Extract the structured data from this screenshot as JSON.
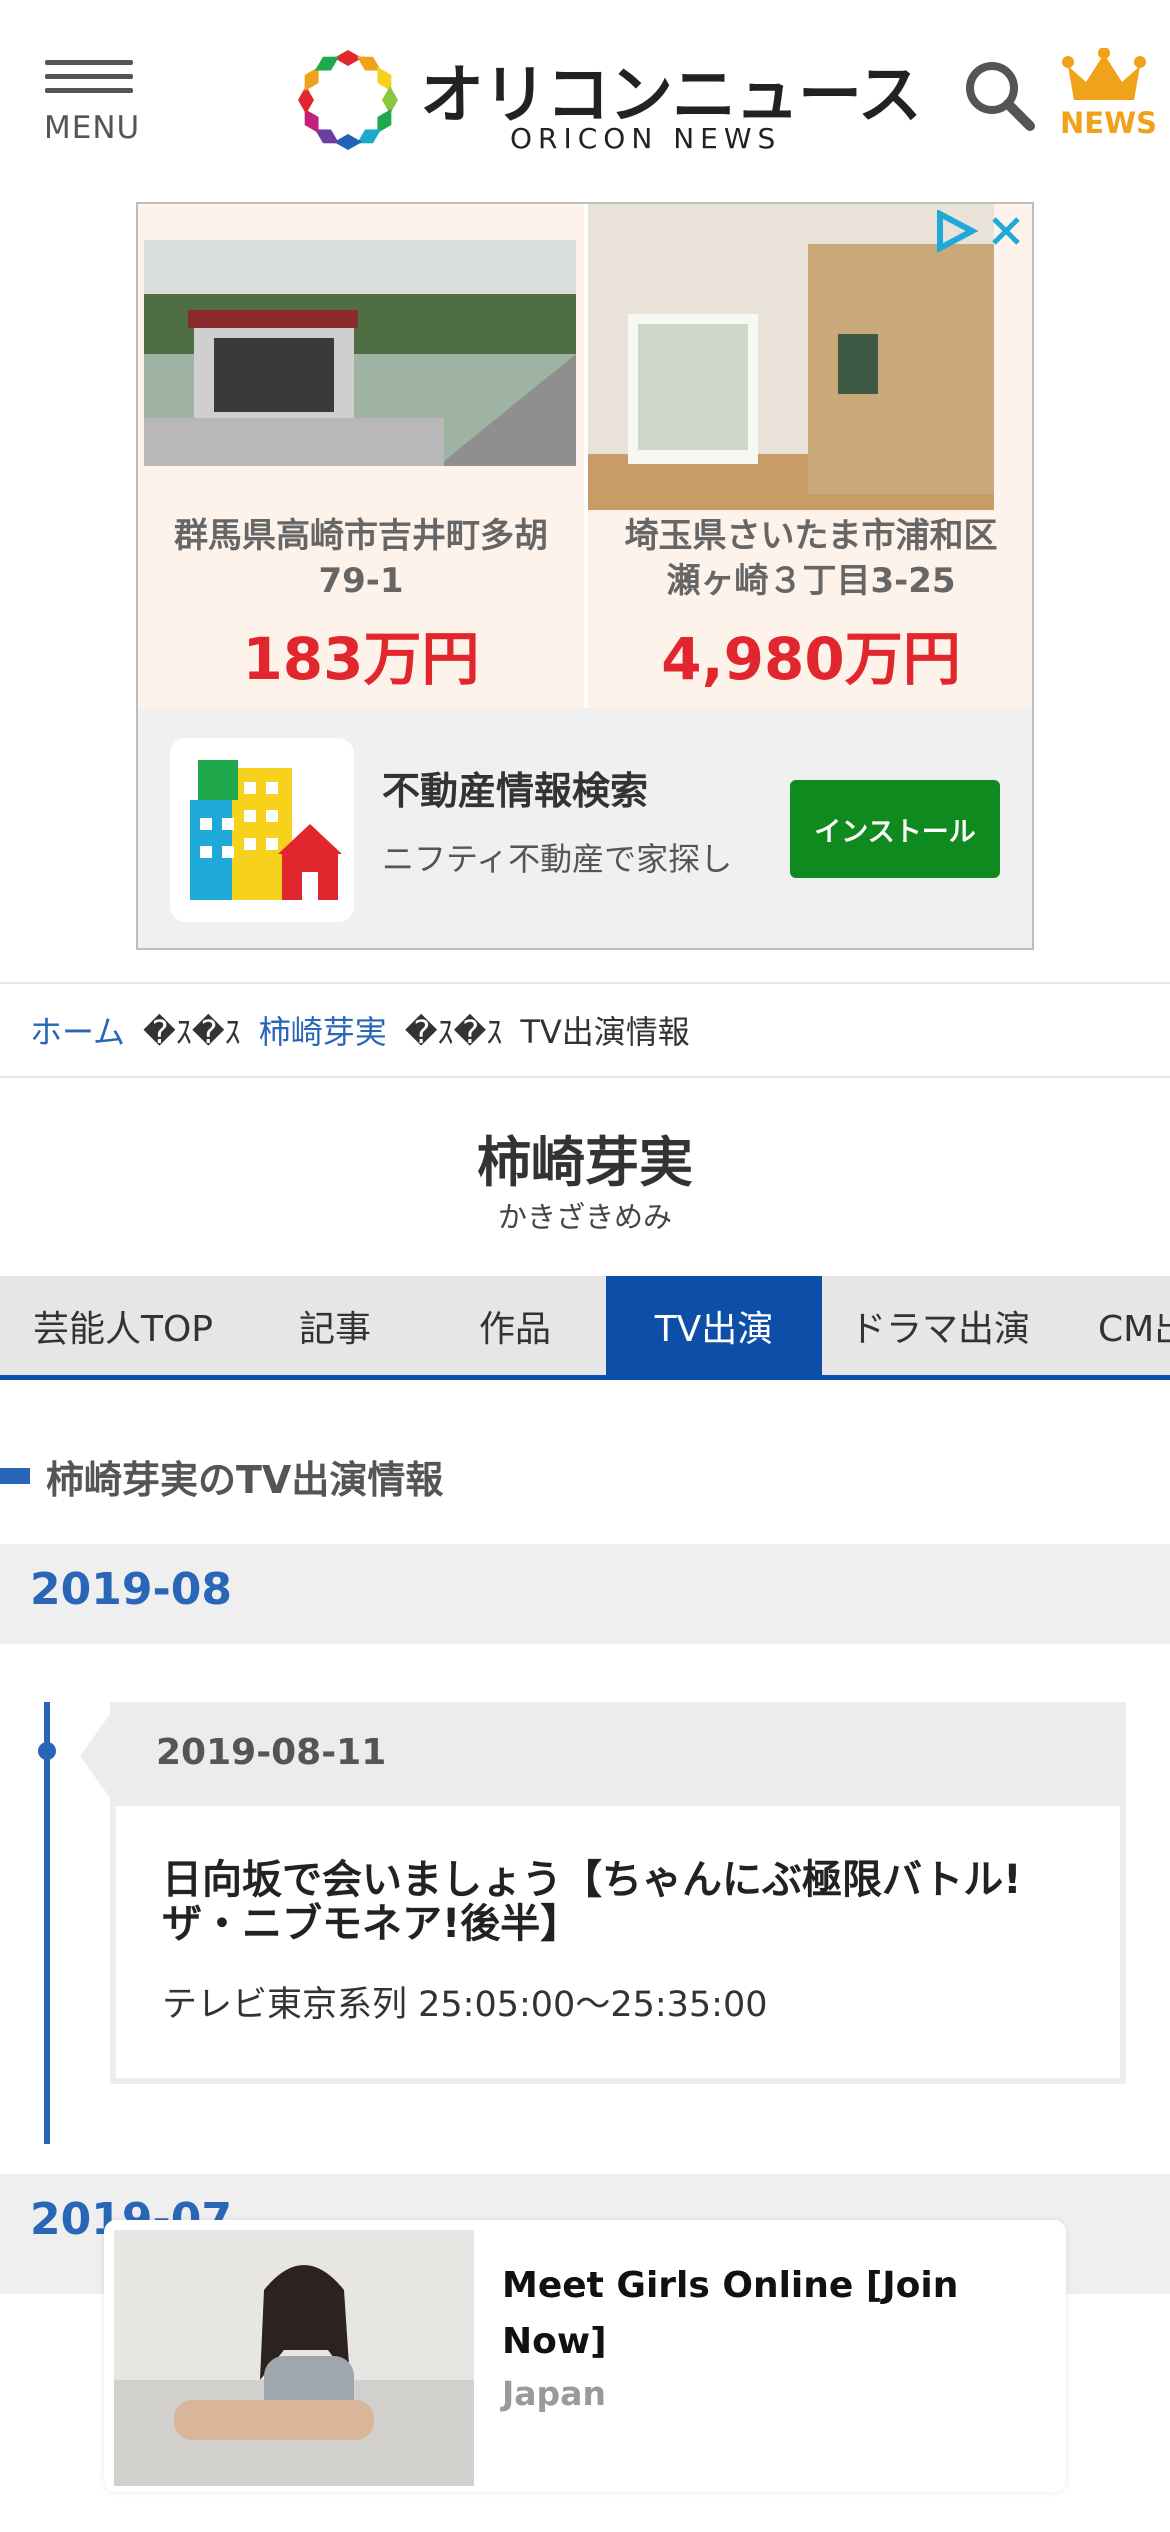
{
  "header": {
    "menu_label": "MENU",
    "logo_jp": "オリコンニュース",
    "logo_en": "ORICON NEWS",
    "news_label": "NEWS",
    "icons": {
      "menu": "hamburger-icon",
      "search": "search-icon",
      "news": "crown-icon"
    },
    "accent_color": "#f0a21a"
  },
  "ad": {
    "cards": [
      {
        "address": "群馬県高崎市吉井町多胡 79-1",
        "address_line1": "群馬県高崎市吉井町多胡",
        "address_line2": "79-1",
        "price": "183万円"
      },
      {
        "address": "埼玉県さいたま市浦和区 瀬ヶ崎３丁目3-25",
        "address_line1": "埼玉県さいたま市浦和区",
        "address_line2": "瀬ヶ崎３丁目3-25",
        "price": "4,980万円"
      }
    ],
    "app_title": "不動産情報検索",
    "app_desc": "ニフティ不動産で家探し",
    "install_label": "インストール",
    "price_color": "#e2262d",
    "install_color": "#0e8a1f"
  },
  "breadcrumb": {
    "home": "ホーム",
    "separator": "�ｽ�ｽ",
    "artist": "柿崎芽実",
    "current": "TV出演情報"
  },
  "artist": {
    "name": "柿崎芽実",
    "kana": "かきざきめみ"
  },
  "tabs": [
    {
      "label": "芸能人TOP"
    },
    {
      "label": "記事"
    },
    {
      "label": "作品"
    },
    {
      "label": "TV出演",
      "active": true
    },
    {
      "label": "ドラマ出演"
    },
    {
      "label": "CM出演"
    }
  ],
  "section_heading": "柿崎芽実のTV出演情報",
  "months": [
    {
      "label": "2019-08",
      "entries": [
        {
          "date": "2019-08-11",
          "title": "日向坂で会いましょう【ちゃんにぶ極限バトル!ザ・ニブモネア!後半】",
          "title_line1": "日向坂で会いましょう【ちゃんにぶ極限バトル!",
          "title_line2": "ザ・ニブモネア!後半】",
          "channel": "テレビ東京系列 25:05:00～25:35:00"
        }
      ]
    },
    {
      "label": "2019-07"
    }
  ],
  "bottom_ad": {
    "title": "Meet Girls Online [Join Now]",
    "subtitle": "Japan"
  },
  "theme": {
    "primary_blue": "#0d4fa8",
    "link_blue": "#2a66b8"
  }
}
